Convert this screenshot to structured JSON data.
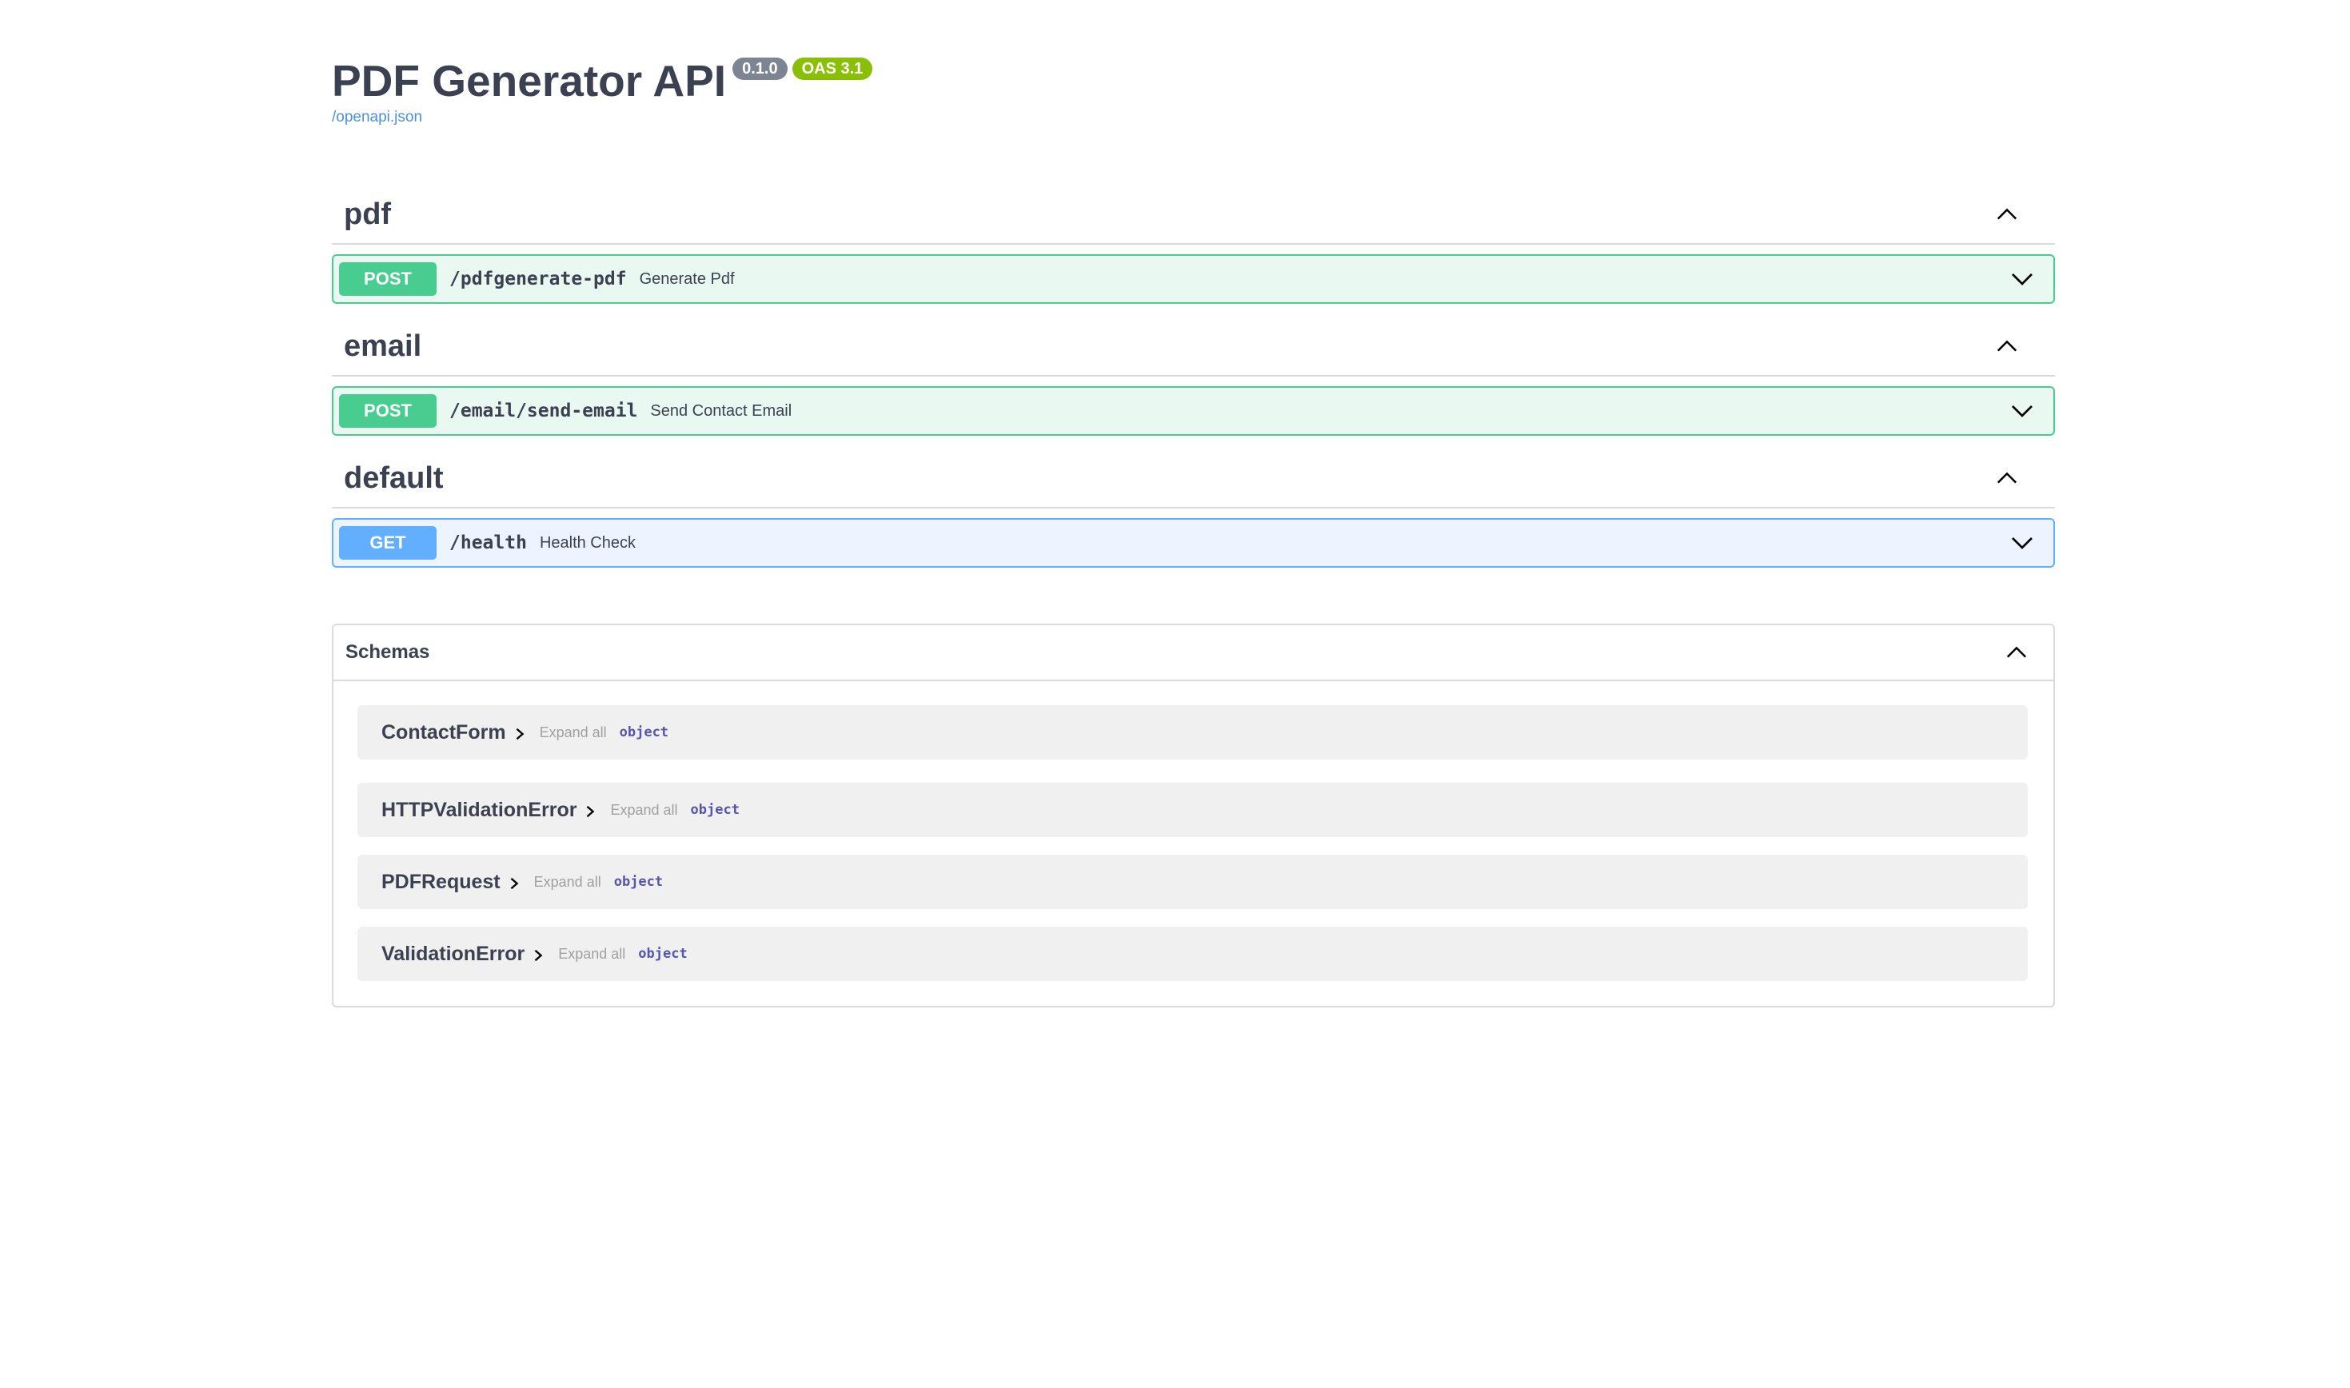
{
  "info": {
    "title": "PDF Generator API",
    "version_badge": "0.1.0",
    "oas_badge": "OAS 3.1",
    "spec_link": "/openapi.json"
  },
  "tags": [
    {
      "name": "pdf",
      "operations": [
        {
          "method": "POST",
          "path": "/pdfgenerate-pdf",
          "summary": "Generate Pdf"
        }
      ]
    },
    {
      "name": "email",
      "operations": [
        {
          "method": "POST",
          "path": "/email/send-email",
          "summary": "Send Contact Email"
        }
      ]
    },
    {
      "name": "default",
      "operations": [
        {
          "method": "GET",
          "path": "/health",
          "summary": "Health Check"
        }
      ]
    }
  ],
  "schemas": {
    "title": "Schemas",
    "models": [
      {
        "name": "ContactForm",
        "expand_label": "Expand all",
        "type": "object"
      },
      {
        "name": "HTTPValidationError",
        "expand_label": "Expand all",
        "type": "object"
      },
      {
        "name": "PDFRequest",
        "expand_label": "Expand all",
        "type": "object"
      },
      {
        "name": "ValidationError",
        "expand_label": "Expand all",
        "type": "object"
      }
    ]
  },
  "colors": {
    "post": "#49cc90",
    "get": "#61affe",
    "version_badge": "#7d8492",
    "oas_badge": "#89bf04",
    "link": "#4990e2"
  },
  "icons": {
    "tag_toggle": "chevron-up-icon",
    "operation_toggle": "chevron-down-icon",
    "model_toggle": "chevron-right-icon"
  }
}
